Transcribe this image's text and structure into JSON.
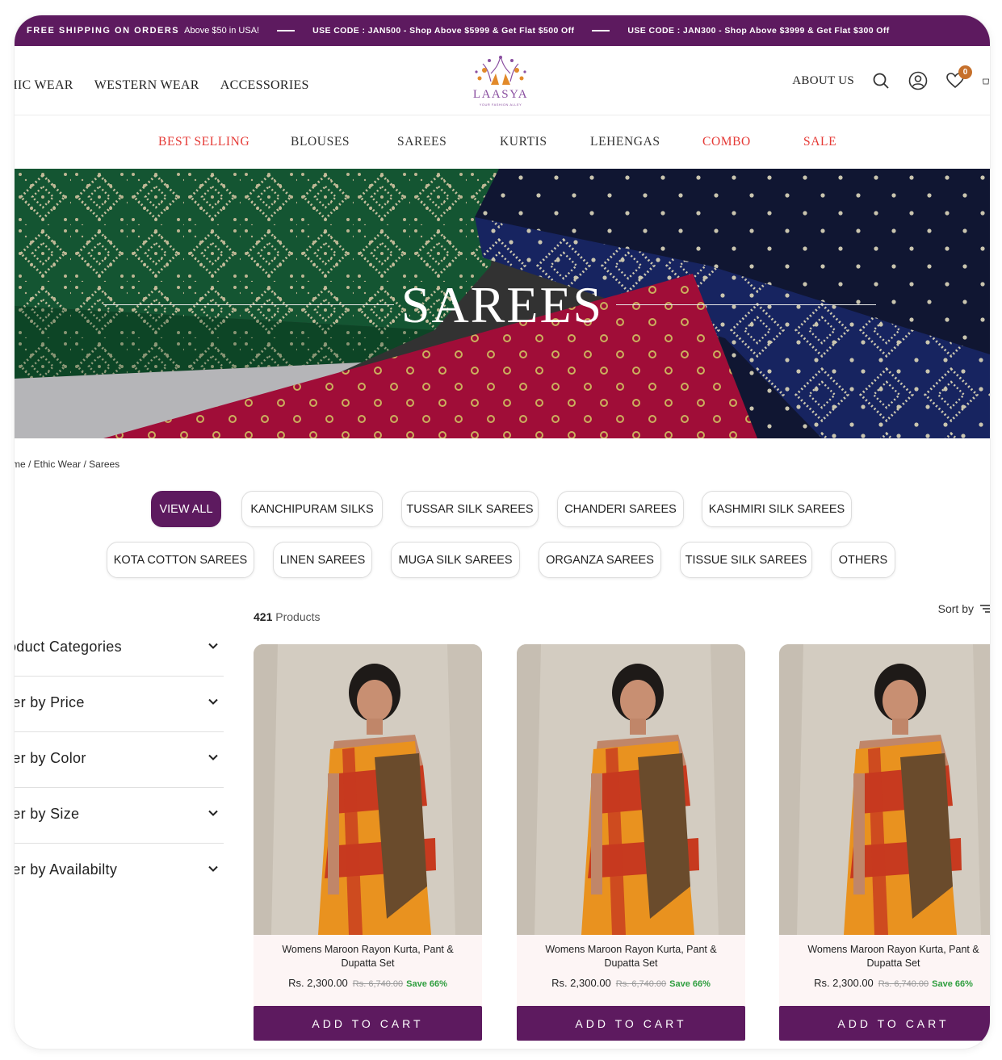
{
  "announcement": {
    "free_shipping_bold": "FREE SHIPPING ON ORDERS",
    "free_shipping_rest": "Above $50 in USA!",
    "code_1": "USE CODE : JAN500 - Shop Above $5999 & Get Flat $500 Off",
    "code_2": "USE CODE : JAN300 - Shop Above $3999 & Get Flat $300 Off"
  },
  "header": {
    "nav": [
      "HIC WEAR",
      "WESTERN WEAR",
      "ACCESSORIES"
    ],
    "logo_text": "LAASYA",
    "logo_tagline": "YOUR FASHION ALLEY",
    "about": "ABOUT US",
    "wishlist_count": "0",
    "icons": [
      "search-icon",
      "user-icon",
      "heart-icon",
      "cart-icon"
    ]
  },
  "categories": [
    "BEST SELLING",
    "BLOUSES",
    "SAREES",
    "KURTIS",
    "LEHENGAS",
    "COMBO",
    "SALE"
  ],
  "highlight_color": "#e53935",
  "accent_color": "#5d1a5f",
  "hero": {
    "title": "SAREES"
  },
  "breadcrumb": "me / Ethic Wear / Sarees",
  "chips_row1": [
    "VIEW ALL",
    "KANCHIPURAM SILKS",
    "TUSSAR SILK SAREES",
    "CHANDERI SAREES",
    "KASHMIRI SILK SAREES"
  ],
  "chips_row2": [
    "KOTA COTTON SAREES",
    "LINEN SAREES",
    "MUGA SILK SAREES",
    "ORGANZA SAREES",
    "TISSUE SILK SAREES",
    "OTHERS"
  ],
  "filters": [
    "oduct Categories",
    "ter by Price",
    "ter by Color",
    "ter by Size",
    "ter by Availabilty"
  ],
  "results": {
    "count": "421",
    "count_label": "Products",
    "sort_label": "Sort by"
  },
  "products": [
    {
      "title": "Womens Maroon Rayon Kurta, Pant & Dupatta Set",
      "price": "Rs. 2,300.00",
      "was": "Rs. 6,740.00",
      "save": "Save 66%",
      "button": "ADD TO CART"
    },
    {
      "title": "Womens Maroon Rayon Kurta, Pant & Dupatta Set",
      "price": "Rs. 2,300.00",
      "was": "Rs. 6,740.00",
      "save": "Save 66%",
      "button": "ADD TO CART"
    },
    {
      "title": "Womens Maroon Rayon Kurta, Pant & Dupatta Set",
      "price": "Rs. 2,300.00",
      "was": "Rs. 6,740.00",
      "save": "Save 66%",
      "button": "ADD TO CART"
    }
  ]
}
